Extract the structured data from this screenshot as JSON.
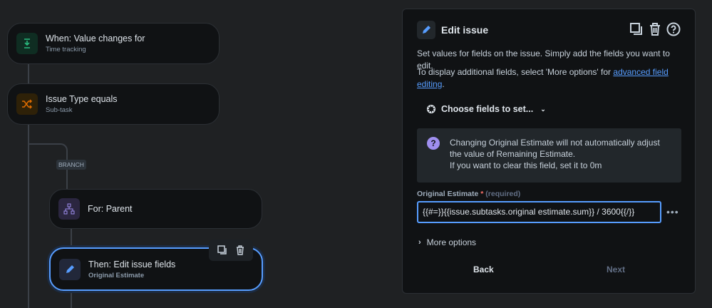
{
  "flow": {
    "trigger": {
      "title": "When: Value changes for",
      "subtitle": "Time tracking"
    },
    "condition": {
      "title": "Issue Type equals",
      "subtitle": "Sub-task"
    },
    "branch_label": "BRANCH",
    "branch": {
      "title": "For: Parent"
    },
    "action": {
      "title": "Then: Edit issue fields",
      "subtitle": "Original Estimate"
    }
  },
  "panel": {
    "title": "Edit issue",
    "desc1": "Set values for fields on the issue. Simply add the fields you want to edit.",
    "desc2_pre": "To display additional fields, select 'More options' for ",
    "desc2_link": "advanced field editing",
    "desc2_post": ".",
    "choose_label": "Choose fields to set...",
    "info_line1": "Changing Original Estimate will not automatically adjust the value of Remaining Estimate.",
    "info_line2": "If you want to clear this field, set it to 0m",
    "field_label": "Original Estimate",
    "field_required_mark": "*",
    "field_required_text": "(required)",
    "field_value": "{{#=}}{{issue.subtasks.original estimate.sum}} / 3600{{/}}",
    "more_options": "More options",
    "back": "Back",
    "next": "Next"
  },
  "colors": {
    "accent": "#579dff",
    "bg": "#1f2123",
    "card": "#101214"
  }
}
